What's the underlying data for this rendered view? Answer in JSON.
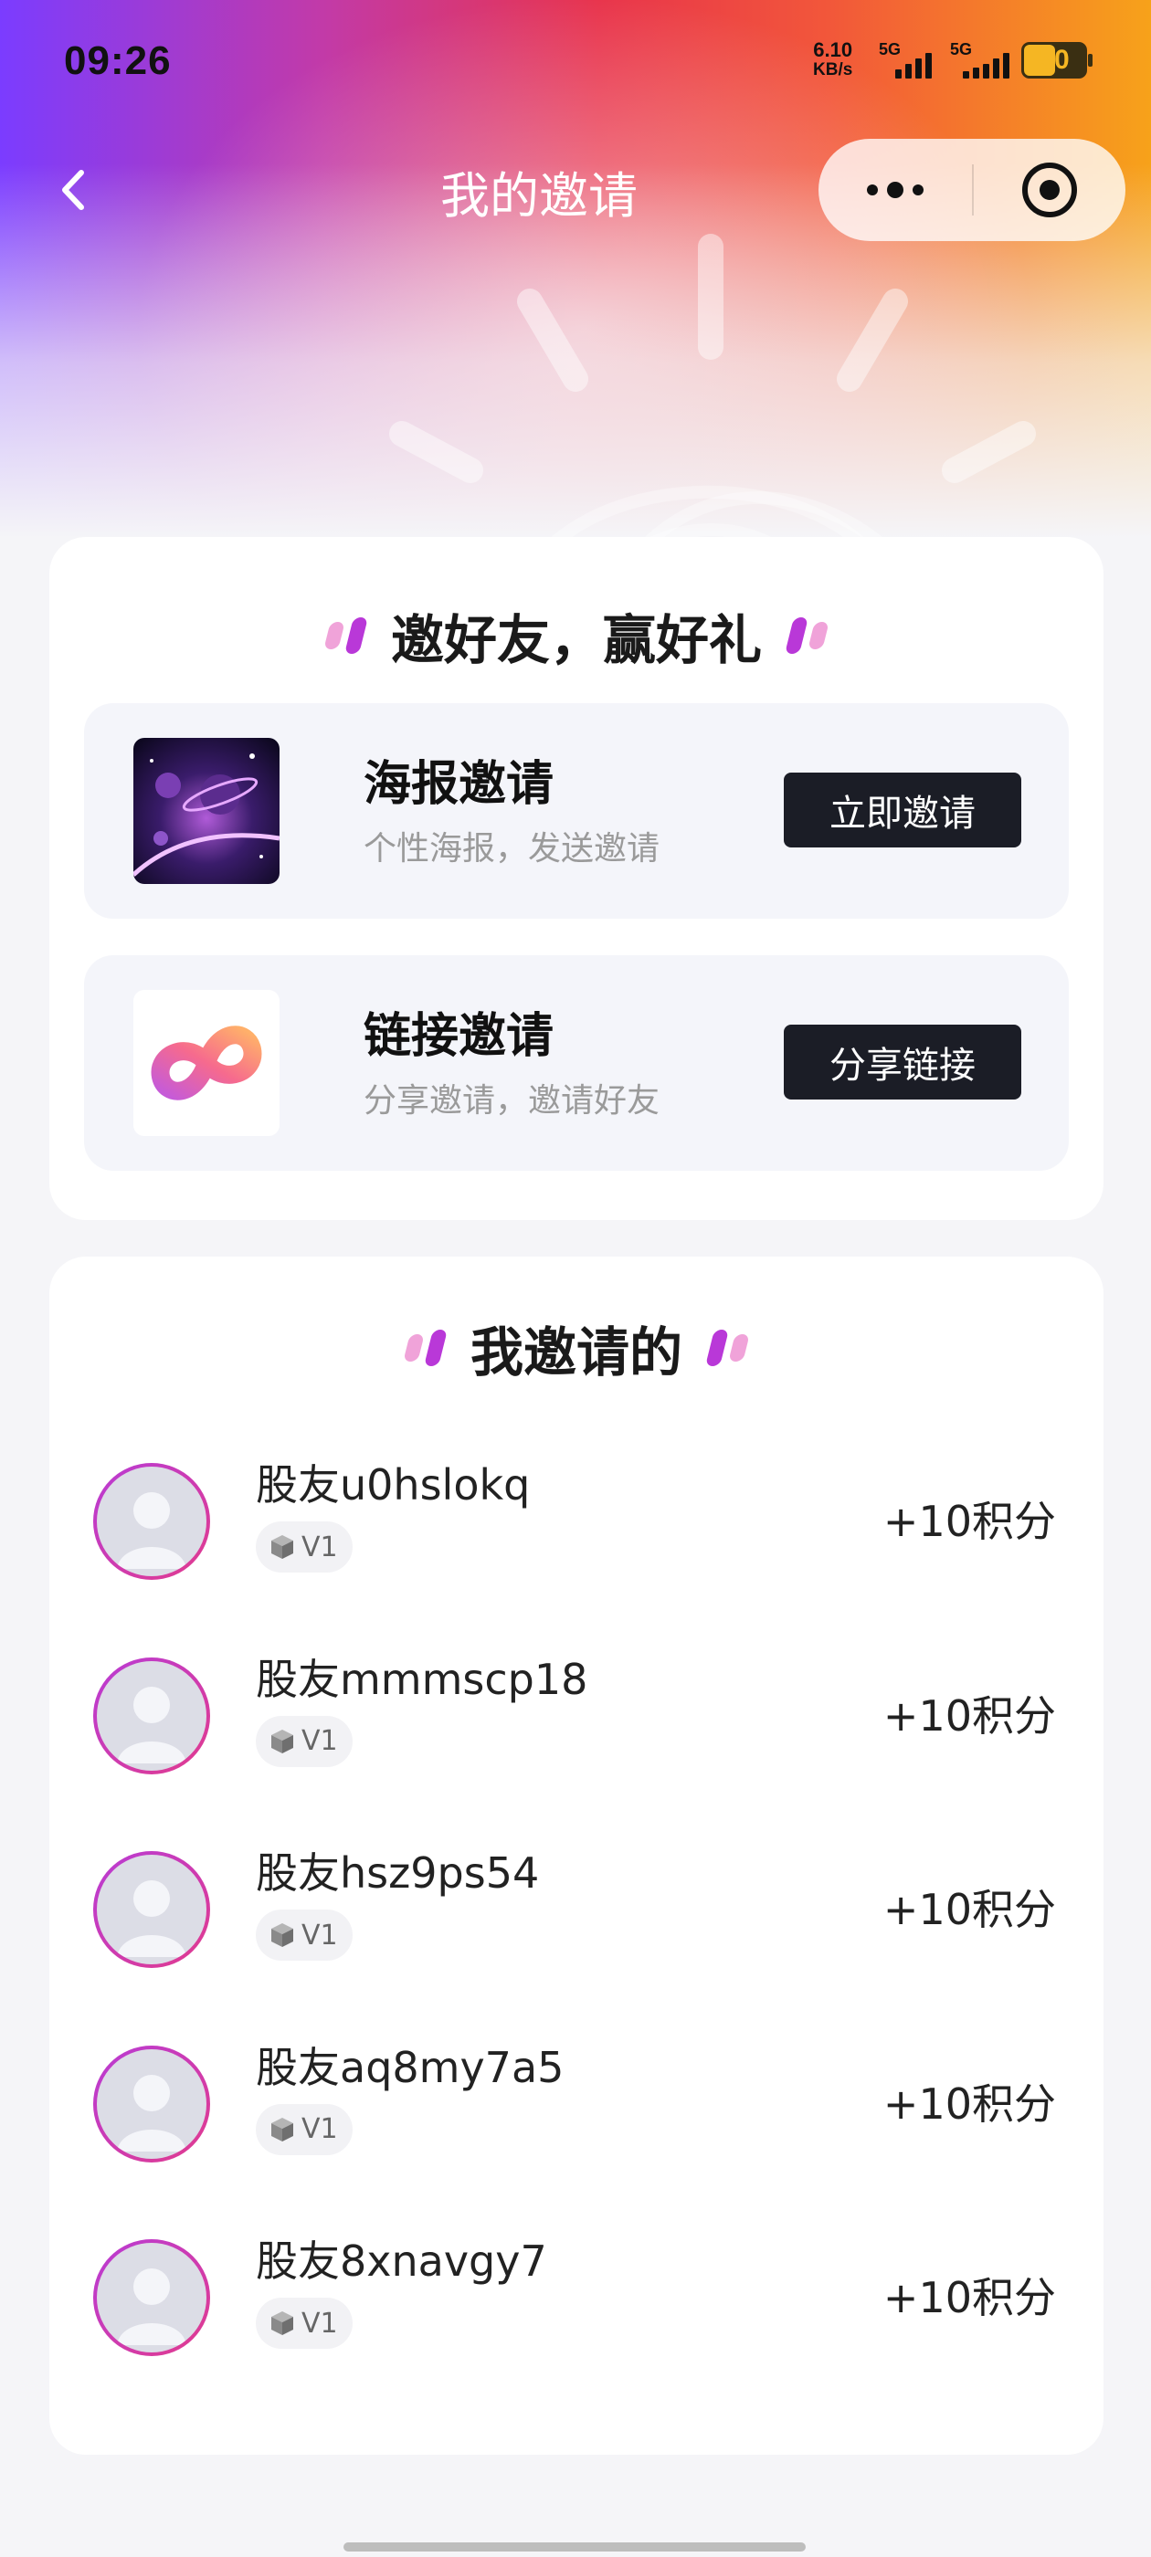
{
  "status_bar": {
    "time": "09:26",
    "net_speed_value": "6.10",
    "net_speed_unit": "KB/s",
    "signal1_label": "5G",
    "signal2_label": "5G",
    "battery": "50"
  },
  "nav": {
    "title": "我的邀请"
  },
  "invite_section": {
    "title": "邀好友，赢好礼",
    "options": [
      {
        "title": "海报邀请",
        "subtitle": "个性海报，发送邀请",
        "button": "立即邀请"
      },
      {
        "title": "链接邀请",
        "subtitle": "分享邀请，邀请好友",
        "button": "分享链接"
      }
    ]
  },
  "invited_section": {
    "title": "我邀请的",
    "friends": [
      {
        "name": "股友u0hslokq",
        "level": "V1",
        "points": "+10积分"
      },
      {
        "name": "股友mmmscp18",
        "level": "V1",
        "points": "+10积分"
      },
      {
        "name": "股友hsz9ps54",
        "level": "V1",
        "points": "+10积分"
      },
      {
        "name": "股友aq8my7a5",
        "level": "V1",
        "points": "+10积分"
      },
      {
        "name": "股友8xnavgy7",
        "level": "V1",
        "points": "+10积分"
      }
    ]
  },
  "colors": {
    "button_bg": "#1b1d26",
    "accent_purple": "#b938d8",
    "accent_pink": "#f0a3d9",
    "gradient": [
      "#7b3cff",
      "#c23aa8",
      "#e8344c",
      "#f7a21a"
    ]
  },
  "icons": [
    "back-arrow-icon",
    "more-dots-icon",
    "target-close-icon",
    "galaxy-poster-thumbnail",
    "infinity-link-icon",
    "avatar-placeholder-icon",
    "level-cube-icon"
  ]
}
